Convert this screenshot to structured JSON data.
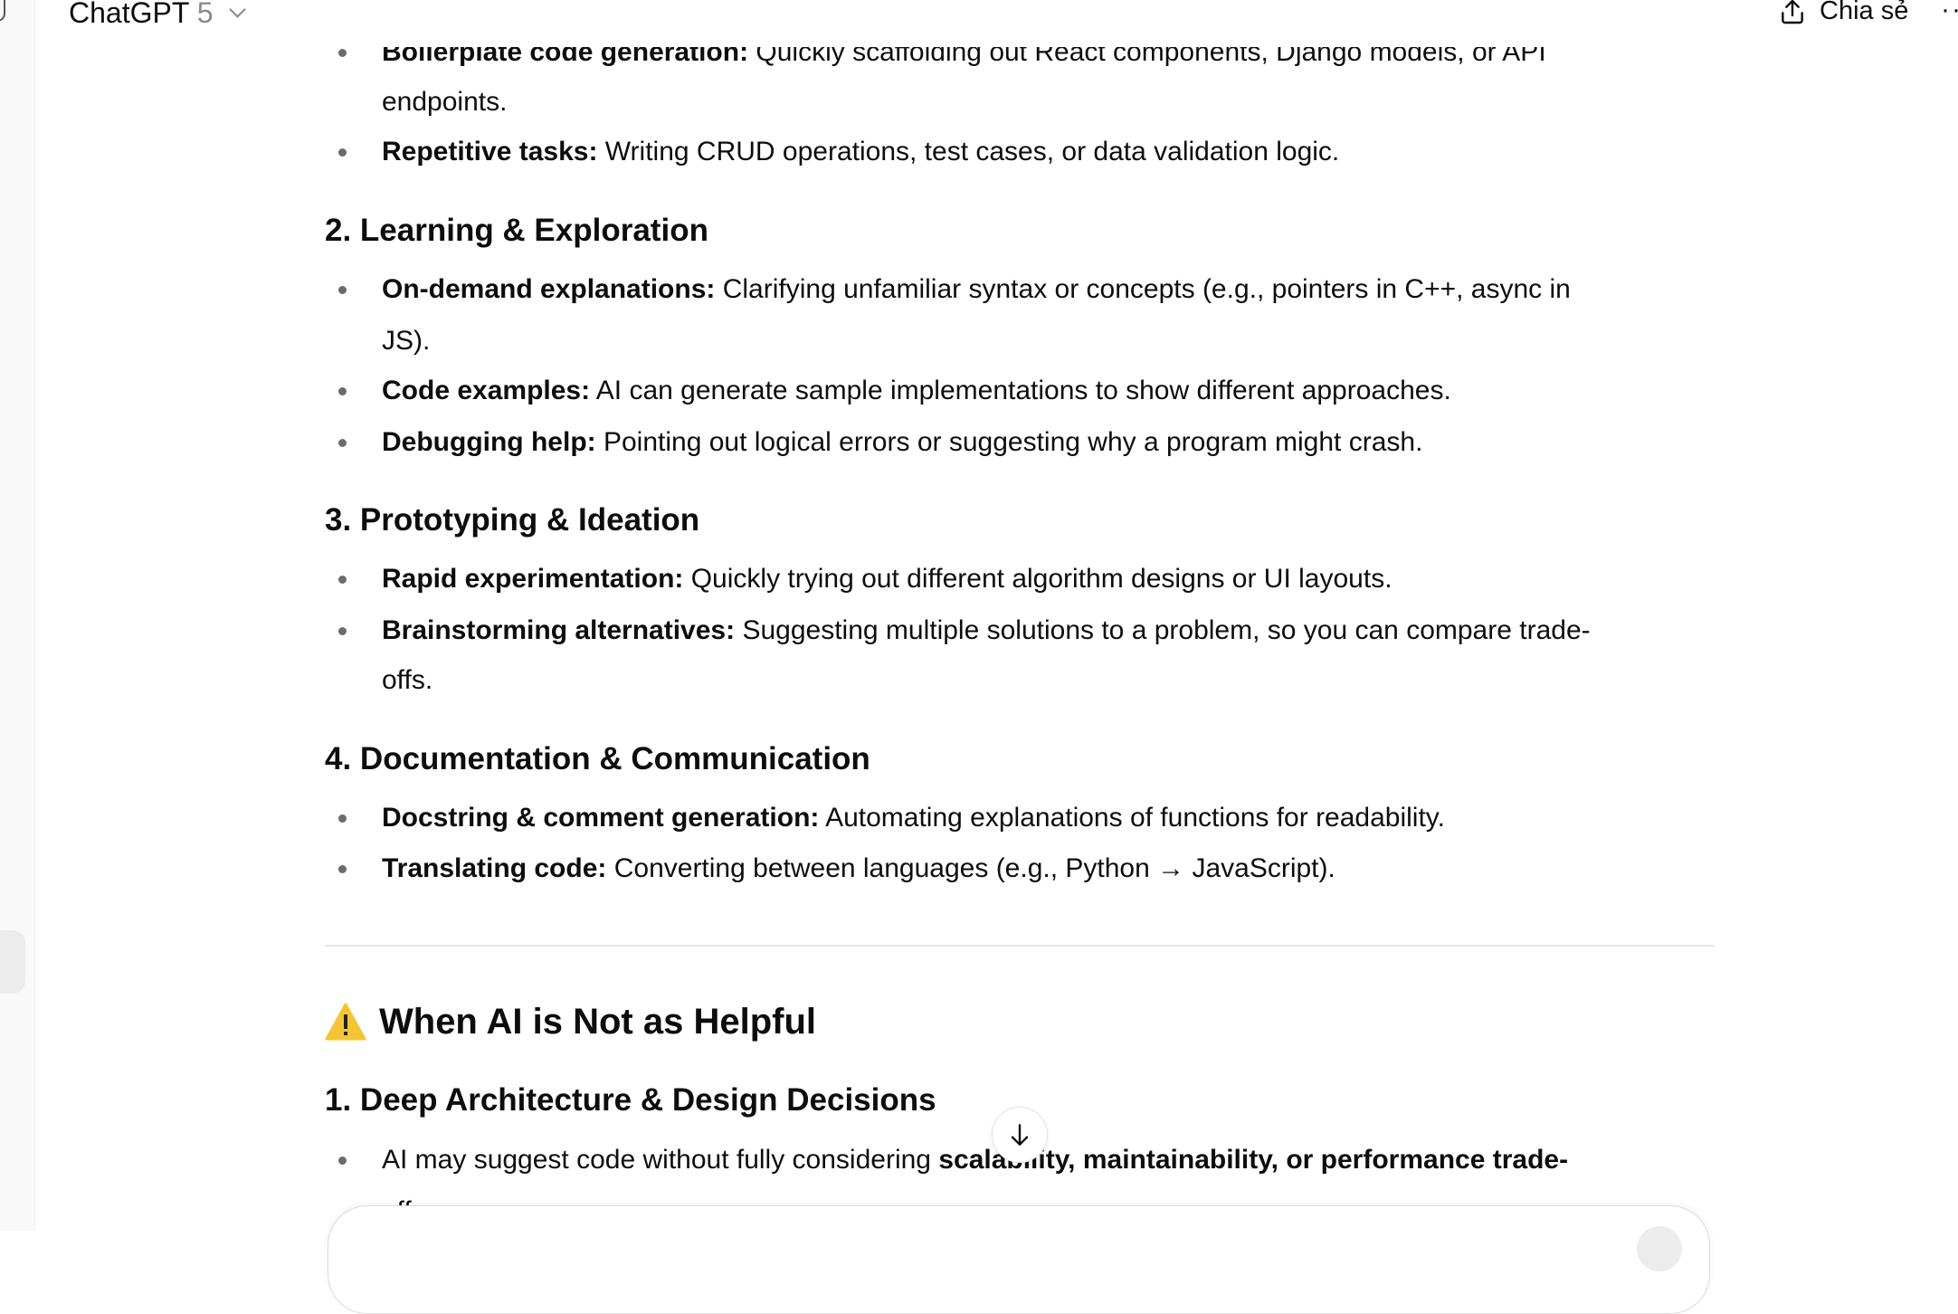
{
  "header": {
    "title": "ChatGPT",
    "version": "5",
    "share_label": "Chia sẻ"
  },
  "content": {
    "top_partial": {
      "bold": "Boilerplate code generation:",
      "text": " Quickly scaffolding out React components, Django models, or API",
      "cont": "endpoints."
    },
    "top_item": {
      "bold": "Repetitive tasks:",
      "text": " Writing CRUD operations, test cases, or data validation logic."
    },
    "sections": [
      {
        "heading": "2. Learning & Exploration",
        "items": [
          {
            "bold": "On-demand explanations:",
            "text": " Clarifying unfamiliar syntax or concepts (e.g., pointers in C++, async in",
            "cont": "JS)."
          },
          {
            "bold": "Code examples:",
            "text": " AI can generate sample implementations to show different approaches."
          },
          {
            "bold": "Debugging help:",
            "text": " Pointing out logical errors or suggesting why a program might crash."
          }
        ]
      },
      {
        "heading": "3. Prototyping & Ideation",
        "items": [
          {
            "bold": "Rapid experimentation:",
            "text": " Quickly trying out different algorithm designs or UI layouts."
          },
          {
            "bold": "Brainstorming alternatives:",
            "text": " Suggesting multiple solutions to a problem, so you can compare trade-",
            "cont": "offs."
          }
        ]
      },
      {
        "heading": "4. Documentation & Communication",
        "items": [
          {
            "bold": "Docstring & comment generation:",
            "text": " Automating explanations of functions for readability."
          },
          {
            "bold": "Translating code:",
            "text": " Converting between languages (e.g., Python → JavaScript)."
          }
        ]
      }
    ],
    "section2_title": "When AI is Not as Helpful",
    "sub1": "1. Deep Architecture & Design Decisions",
    "sub1_item": {
      "text": "AI may suggest code without fully considering ",
      "bold": "scalability, maintainability, or performance trade-",
      "cont": "offs."
    }
  },
  "colors": {
    "warning": "#f5c531",
    "bullet": "#6b6b6b"
  }
}
